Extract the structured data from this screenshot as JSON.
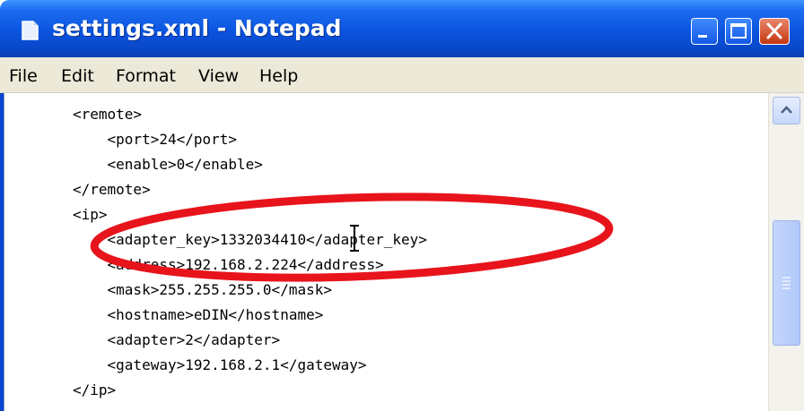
{
  "window": {
    "title": "settings.xml - Notepad",
    "accent_color": "#0a54e0",
    "close_color": "#c3370f",
    "icons": [
      "notepad-icon",
      "minimize-icon",
      "maximize-icon",
      "close-icon"
    ]
  },
  "menu": [
    {
      "label": "File"
    },
    {
      "label": "Edit"
    },
    {
      "label": "Format"
    },
    {
      "label": "View"
    },
    {
      "label": "Help"
    }
  ],
  "editor": {
    "lines": [
      "<remote>",
      "    <port>24</port>",
      "    <enable>0</enable>",
      "</remote>",
      "<ip>",
      "    <adapter_key>1332034410</adapter_key>",
      "    <address>192.168.2.224</address>",
      "    <mask>255.255.255.0</mask>",
      "    <hostname>eDIN</hostname>",
      "    <adapter>2</adapter>",
      "    <gateway>192.168.2.1</gateway>",
      "</ip>"
    ]
  },
  "annotation": {
    "shape": "ellipse",
    "color": "#e8141c",
    "highlighted_line": "<adapter_key>1332034410</adapter_key>"
  },
  "cursor": {
    "type": "i-beam-cursor"
  }
}
